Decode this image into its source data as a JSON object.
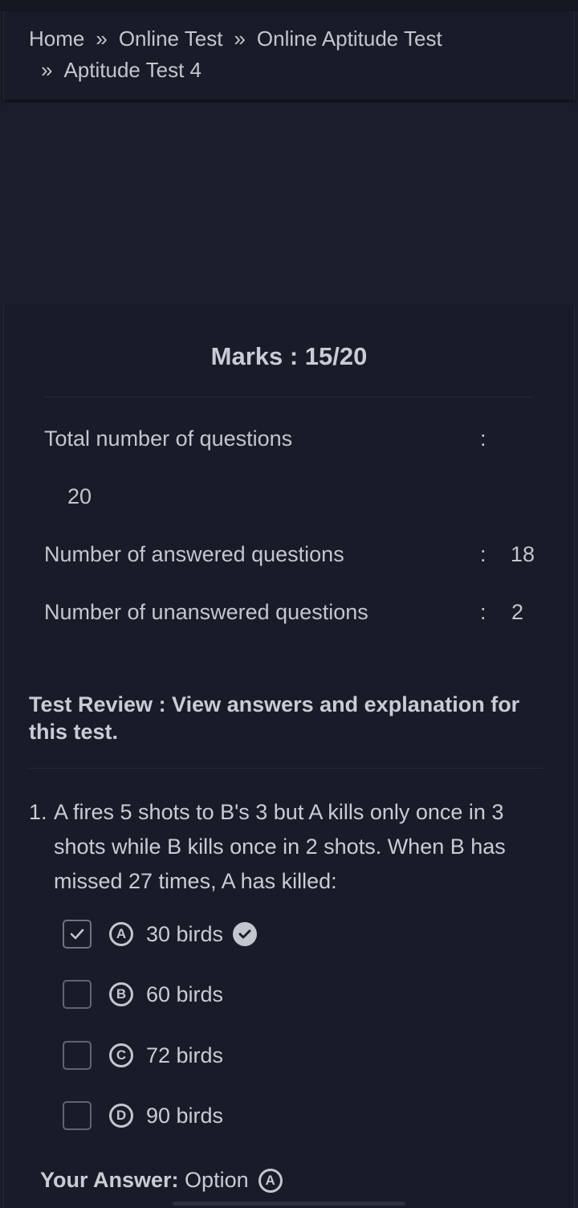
{
  "breadcrumb": {
    "items": [
      "Home",
      "Online Test",
      "Online Aptitude Test",
      "Aptitude Test 4"
    ],
    "separator": "»"
  },
  "result": {
    "marks": "Marks : 15/20",
    "stats": [
      {
        "label": "Total number of questions",
        "value": "20"
      },
      {
        "label": "Number of answered questions",
        "value": "18"
      },
      {
        "label": "Number of unanswered questions",
        "value": "2"
      }
    ],
    "colon": ":"
  },
  "review": {
    "heading": "Test Review : View answers and explanation for this test."
  },
  "question": {
    "number": "1.",
    "text": "A fires 5 shots to B's 3 but A kills only once in 3 shots while B kills once in 2 shots. When B has missed 27 times, A has killed:",
    "options": [
      {
        "letter": "A",
        "text": "30 birds",
        "checked": true,
        "correct": true
      },
      {
        "letter": "B",
        "text": "60 birds",
        "checked": false,
        "correct": false
      },
      {
        "letter": "C",
        "text": "72 birds",
        "checked": false,
        "correct": false
      },
      {
        "letter": "D",
        "text": "90 birds",
        "checked": false,
        "correct": false
      }
    ],
    "your_answer_label": "Your Answer:",
    "your_answer_prefix": "Option",
    "your_answer_letter": "A"
  },
  "colors": {
    "background": "#1b1e2a",
    "panel": "#191c28",
    "text": "#c9ccd4"
  }
}
